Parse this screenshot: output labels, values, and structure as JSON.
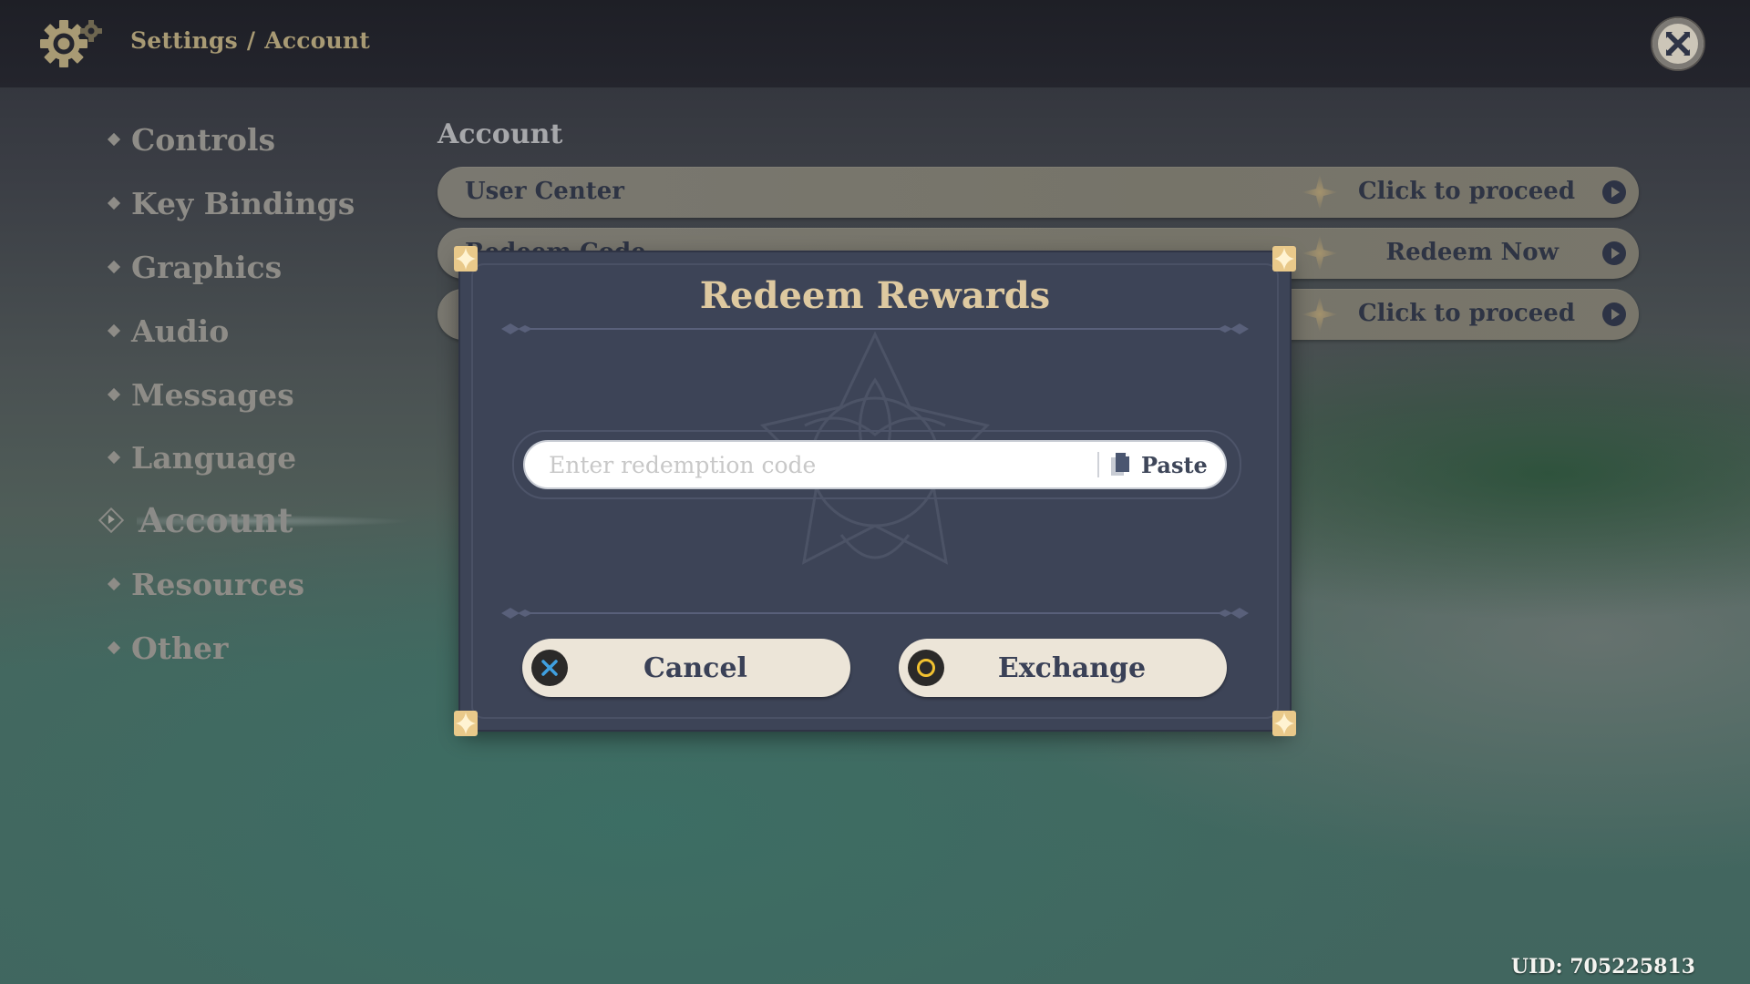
{
  "header": {
    "breadcrumb": [
      "Settings",
      "Account"
    ],
    "breadcrumb_separator": "/",
    "icons": {
      "settings": "gear-icon",
      "close": "close-icon"
    }
  },
  "sidebar": {
    "items": [
      {
        "label": "Controls",
        "active": false
      },
      {
        "label": "Key Bindings",
        "active": false
      },
      {
        "label": "Graphics",
        "active": false
      },
      {
        "label": "Audio",
        "active": false
      },
      {
        "label": "Messages",
        "active": false
      },
      {
        "label": "Language",
        "active": false
      },
      {
        "label": "Account",
        "active": true
      },
      {
        "label": "Resources",
        "active": false
      },
      {
        "label": "Other",
        "active": false
      }
    ]
  },
  "main": {
    "section_title": "Account",
    "rows": [
      {
        "label": "User Center",
        "action": "Click to proceed"
      },
      {
        "label": "Redeem Code",
        "action": "Redeem Now"
      },
      {
        "label": "",
        "action": "Click to proceed"
      }
    ]
  },
  "dialog": {
    "title": "Redeem Rewards",
    "input": {
      "value": "",
      "placeholder": "Enter redemption code"
    },
    "paste_label": "Paste",
    "cancel_label": "Cancel",
    "exchange_label": "Exchange",
    "cancel_badge_icon": "cross-button-icon",
    "exchange_badge_icon": "circle-button-icon"
  },
  "footer": {
    "uid": "UID: 705225813"
  },
  "colors": {
    "accent_gold": "#dec9a0",
    "dialog_bg": "#3d4457",
    "button_bg": "#ece5d8",
    "cancel_icon": "#3fa0e0",
    "exchange_icon": "#f2c230"
  }
}
